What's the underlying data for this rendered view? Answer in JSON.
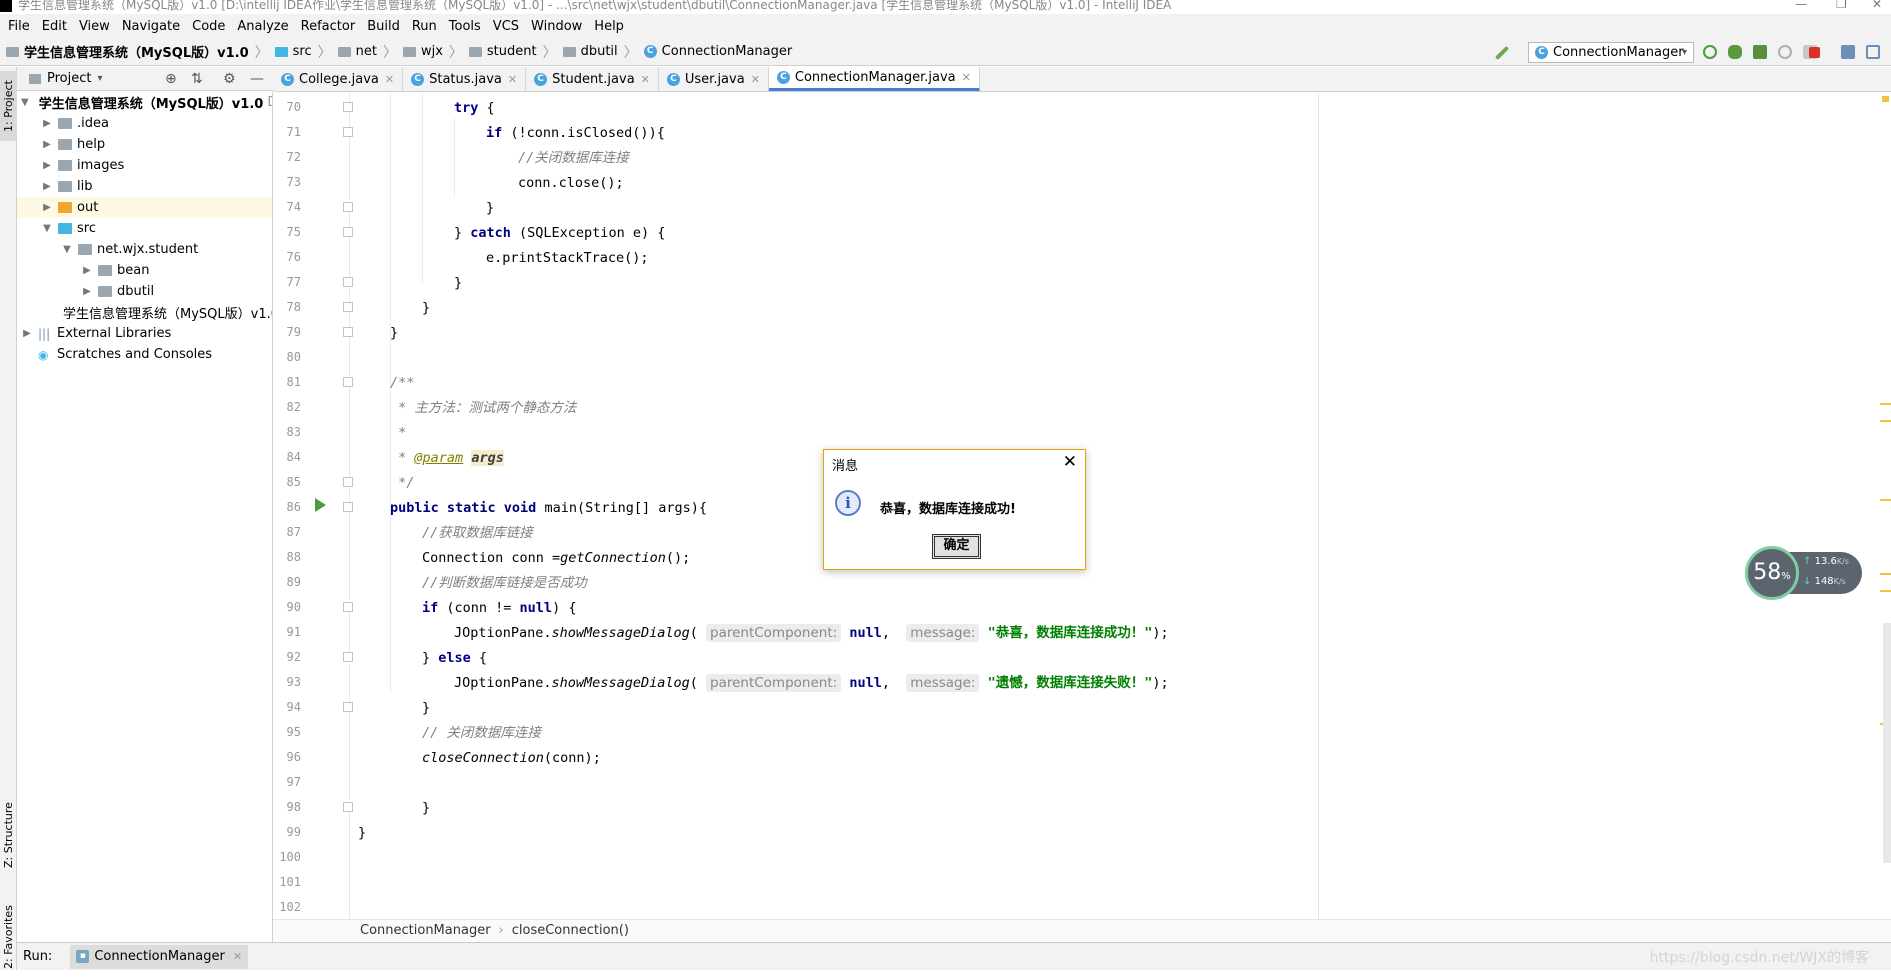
{
  "window": {
    "title": "学生信息管理系统（MySQL版）v1.0 [D:\\intellij IDEA作业\\学生信息管理系统（MySQL版）v1.0] - ...\\src\\net\\wjx\\student\\dbutil\\ConnectionManager.java [学生信息管理系统（MySQL版）v1.0] - IntelliJ IDEA"
  },
  "menu": [
    "File",
    "Edit",
    "View",
    "Navigate",
    "Code",
    "Analyze",
    "Refactor",
    "Build",
    "Run",
    "Tools",
    "VCS",
    "Window",
    "Help"
  ],
  "breadcrumb": {
    "project": "学生信息管理系统（MySQL版）v1.0",
    "path": [
      "src",
      "net",
      "wjx",
      "student",
      "dbutil"
    ],
    "file": "ConnectionManager"
  },
  "run_config": "ConnectionManager",
  "left_stripe": {
    "project_tab": "1: Project",
    "structure_tab": "Z: Structure",
    "favorites_tab": "2: Favorites"
  },
  "project_panel": {
    "title": "Project",
    "tree": [
      {
        "label": "学生信息管理系统（MySQL版）v1.0",
        "suffix": "D",
        "bold": true
      },
      {
        "label": ".idea"
      },
      {
        "label": "help"
      },
      {
        "label": "images"
      },
      {
        "label": "lib"
      },
      {
        "label": "out"
      },
      {
        "label": "src"
      },
      {
        "label": "net.wjx.student"
      },
      {
        "label": "bean"
      },
      {
        "label": "dbutil"
      },
      {
        "label": "学生信息管理系统（MySQL版）v1.0"
      },
      {
        "label": "External Libraries"
      },
      {
        "label": "Scratches and Consoles"
      }
    ]
  },
  "tabs": [
    "College.java",
    "Status.java",
    "Student.java",
    "User.java",
    "ConnectionManager.java"
  ],
  "code": {
    "line_numbers": [
      "70",
      "71",
      "72",
      "73",
      "74",
      "75",
      "76",
      "77",
      "78",
      "79",
      "80",
      "81",
      "82",
      "83",
      "84",
      "85",
      "86",
      "87",
      "88",
      "89",
      "90",
      "91",
      "92",
      "93",
      "94",
      "95",
      "96",
      "97",
      "98",
      "99",
      "100",
      "101",
      "102"
    ],
    "lines": {
      "l70": "try",
      "l71a": "if",
      "l71b": " (!conn.isClosed()){",
      "l72": "//关闭数据库连接",
      "l73": "conn.close();",
      "l74": "}",
      "l75a": "} ",
      "l75b": "catch",
      "l75c": " (SQLException e) {",
      "l76": "e.printStackTrace();",
      "l77": "}",
      "l78": "}",
      "l79": "}",
      "l81": "/**",
      "l82": " * 主方法：测试两个静态方法",
      "l83": " *",
      "l84a": " * ",
      "l84b": "@param",
      "l84c": " ",
      "l84d": "args",
      "l85": " */",
      "l86a": "public static void",
      "l86b": " main(String[] args){",
      "l87": "//获取数据库链接",
      "l88a": "Connection conn =",
      "l88b": "getConnection",
      "l88c": "();",
      "l89": "//判断数据库链接是否成功",
      "l90a": "if",
      "l90b": " (conn != ",
      "l90c": "null",
      "l90d": ") {",
      "l91a": "JOptionPane.",
      "l91b": "showMessageDialog",
      "l91c": "(",
      "hint_parent": "parentComponent:",
      "null_kw": "null",
      "comma": ",",
      "hint_message": "message:",
      "l91s": "\"恭喜，数据库连接成功！\"",
      "l91e": ");",
      "l92a": "} ",
      "l92b": "else",
      "l92c": " {",
      "l93s": "\"遗憾，数据库连接失败！\"",
      "l94": "}",
      "l95": "// 关闭数据库连接",
      "l96a": "closeConnection",
      "l96b": "(conn);",
      "l98": "}",
      "l99": "}"
    }
  },
  "editor_breadcrumb": [
    "ConnectionManager",
    "closeConnection()"
  ],
  "dialog": {
    "title": "消息",
    "message": "恭喜，数据库连接成功!",
    "ok_label": "确定"
  },
  "net_widget": {
    "percent": "58",
    "percent_unit": "%",
    "upload": "13.6",
    "download": "148",
    "unit": "K/s"
  },
  "run_bar": {
    "label": "Run:",
    "tab": "ConnectionManager"
  },
  "watermark": "https://blog.csdn.net/WJX的博客"
}
